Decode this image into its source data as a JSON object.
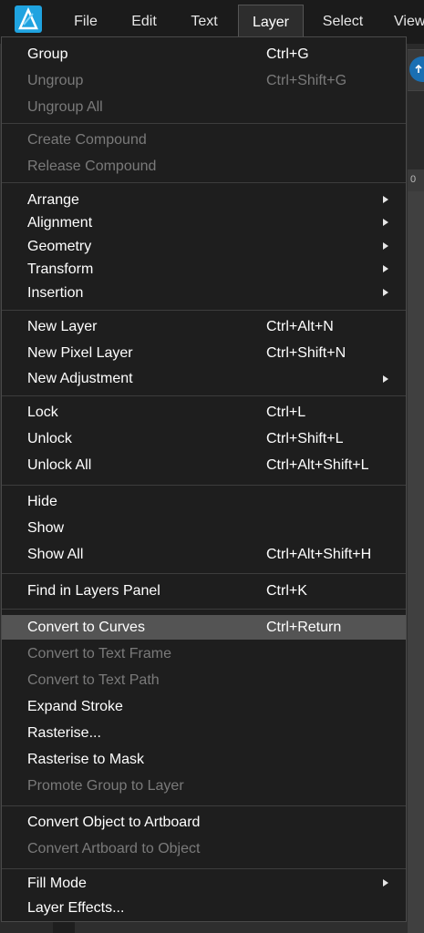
{
  "menubar": {
    "items": [
      {
        "label": "File"
      },
      {
        "label": "Edit"
      },
      {
        "label": "Text"
      },
      {
        "label": "Layer"
      },
      {
        "label": "Select"
      },
      {
        "label": "View"
      }
    ],
    "active": "Layer"
  },
  "background": {
    "ruler_text": "0"
  },
  "layer_menu": {
    "items": [
      {
        "label": "Group",
        "shortcut": "Ctrl+G",
        "enabled": true
      },
      {
        "label": "Ungroup",
        "shortcut": "Ctrl+Shift+G",
        "enabled": false
      },
      {
        "label": "Ungroup All",
        "shortcut": "",
        "enabled": false
      },
      {
        "label": "Create Compound",
        "shortcut": "",
        "enabled": false
      },
      {
        "label": "Release Compound",
        "shortcut": "",
        "enabled": false
      },
      {
        "label": "Arrange",
        "submenu": true,
        "enabled": true
      },
      {
        "label": "Alignment",
        "submenu": true,
        "enabled": true
      },
      {
        "label": "Geometry",
        "submenu": true,
        "enabled": true
      },
      {
        "label": "Transform",
        "submenu": true,
        "enabled": true
      },
      {
        "label": "Insertion",
        "submenu": true,
        "enabled": true
      },
      {
        "label": "New Layer",
        "shortcut": "Ctrl+Alt+N",
        "enabled": true
      },
      {
        "label": "New Pixel Layer",
        "shortcut": "Ctrl+Shift+N",
        "enabled": true
      },
      {
        "label": "New Adjustment",
        "submenu": true,
        "enabled": true
      },
      {
        "label": "Lock",
        "shortcut": "Ctrl+L",
        "enabled": true
      },
      {
        "label": "Unlock",
        "shortcut": "Ctrl+Shift+L",
        "enabled": true
      },
      {
        "label": "Unlock All",
        "shortcut": "Ctrl+Alt+Shift+L",
        "enabled": true
      },
      {
        "label": "Hide",
        "shortcut": "",
        "enabled": true
      },
      {
        "label": "Show",
        "shortcut": "",
        "enabled": true
      },
      {
        "label": "Show All",
        "shortcut": "Ctrl+Alt+Shift+H",
        "enabled": true
      },
      {
        "label": "Find in Layers Panel",
        "shortcut": "Ctrl+K",
        "enabled": true
      },
      {
        "label": "Convert to Curves",
        "shortcut": "Ctrl+Return",
        "enabled": true,
        "highlighted": true
      },
      {
        "label": "Convert to Text Frame",
        "shortcut": "",
        "enabled": false
      },
      {
        "label": "Convert to Text Path",
        "shortcut": "",
        "enabled": false
      },
      {
        "label": "Expand Stroke",
        "shortcut": "",
        "enabled": true
      },
      {
        "label": "Rasterise...",
        "shortcut": "",
        "enabled": true
      },
      {
        "label": "Rasterise to Mask",
        "shortcut": "",
        "enabled": true
      },
      {
        "label": "Promote Group to Layer",
        "shortcut": "",
        "enabled": false
      },
      {
        "label": "Convert Object to Artboard",
        "shortcut": "",
        "enabled": true
      },
      {
        "label": "Convert Artboard to Object",
        "shortcut": "",
        "enabled": false
      },
      {
        "label": "Fill Mode",
        "submenu": true,
        "enabled": true
      },
      {
        "label": "Layer Effects...",
        "shortcut": "",
        "enabled": true
      }
    ]
  },
  "colors": {
    "menu_bg": "#1e1e1e",
    "highlight": "#545454",
    "disabled_text": "#7a7a7a",
    "brand": "#1fa3e0"
  }
}
